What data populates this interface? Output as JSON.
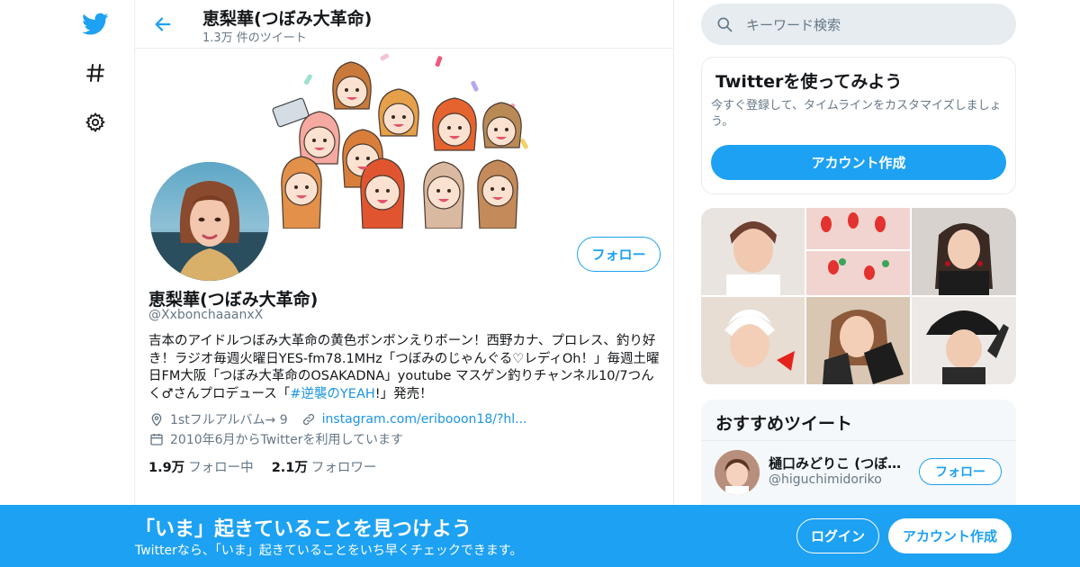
{
  "colors": {
    "accent": "#1da1f2",
    "link": "#1b95e0",
    "muted": "#657786",
    "text": "#14171a",
    "border": "#e6ecf0"
  },
  "left_nav": {
    "icons": [
      "twitter-logo-icon",
      "hashtag-icon",
      "settings-gear-icon"
    ]
  },
  "header": {
    "title": "恵梨華(つぼみ大革命)",
    "tweet_count": "1.3万 件のツイート"
  },
  "profile": {
    "name": "恵梨華(つぼみ大革命)",
    "handle": "@XxbonchaaanxX",
    "follow_label": "フォロー",
    "bio_part1": "吉本のアイドルつぼみ大革命の黄色ボンボンえりボーン！西野カナ、プロレス、釣り好き！ラジオ毎週火曜日YES-fm78.1MHz「つぼみのじゃんぐる♡レディOh！」毎週土曜日FM大阪「つぼみ大革命のOSAKADNA」youtube マスゲン釣りチャンネル10/7つんく♂さんプロデュース「",
    "bio_hashtag": "#逆襲のYEAH",
    "bio_part2": "!」発売！",
    "location": "1stフルアルバム→ 9",
    "website": "instagram.com/eribooon18/?hl...",
    "joined": "2010年6月からTwitterを利用しています",
    "following_count": "1.9万",
    "following_label": "フォロー中",
    "followers_count": "2.1万",
    "followers_label": "フォロワー"
  },
  "search": {
    "placeholder": "キーワード検索"
  },
  "signup_card": {
    "title": "Twitterを使ってみよう",
    "description": "今すぐ登録して、タイムラインをカスタマイズしましょう。",
    "button": "アカウント作成"
  },
  "media": {
    "tile_count": 6
  },
  "recommended": {
    "title": "おすすめツイート",
    "user": {
      "name": "樋口みどりこ (つぼみ大革命)",
      "handle": "@higuchimidoriko",
      "follow_label": "フォロー"
    }
  },
  "bottom_bar": {
    "title": "「いま」起きていることを見つけよう",
    "subtitle": "Twitterなら、「いま」起きていることをいち早くチェックできます。",
    "login": "ログイン",
    "signup": "アカウント作成"
  }
}
